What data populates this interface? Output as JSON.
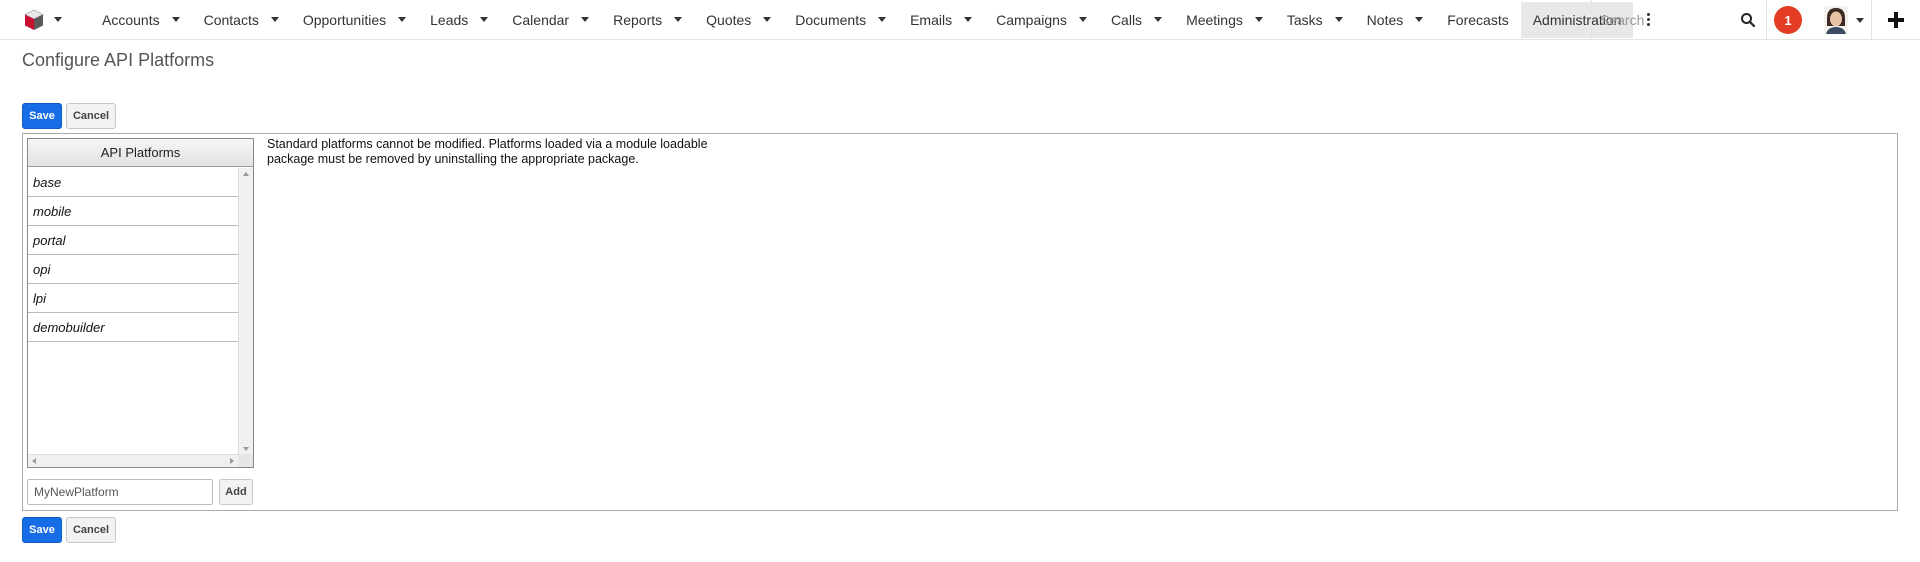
{
  "nav": {
    "tabs": [
      {
        "label": "Accounts"
      },
      {
        "label": "Contacts"
      },
      {
        "label": "Opportunities"
      },
      {
        "label": "Leads"
      },
      {
        "label": "Calendar"
      },
      {
        "label": "Reports"
      },
      {
        "label": "Quotes"
      },
      {
        "label": "Documents"
      },
      {
        "label": "Emails"
      },
      {
        "label": "Campaigns"
      },
      {
        "label": "Calls"
      },
      {
        "label": "Meetings"
      },
      {
        "label": "Tasks"
      },
      {
        "label": "Notes"
      },
      {
        "label": "Forecasts"
      },
      {
        "label": "Administration"
      }
    ],
    "search_placeholder": "Search",
    "notification_count": "1"
  },
  "page": {
    "title": "Configure API Platforms",
    "save_label": "Save",
    "cancel_label": "Cancel"
  },
  "platforms": {
    "header": "API Platforms",
    "items": [
      "base",
      "mobile",
      "portal",
      "opi",
      "lpi",
      "demobuilder"
    ],
    "info_text": "Standard platforms cannot be modified. Platforms loaded via a module loadable package must be removed by uninstalling the appropriate package.",
    "input_value": "MyNewPlatform",
    "add_label": "Add"
  },
  "colors": {
    "primary_button": "#176de5",
    "notification_badge": "#e23d24",
    "active_tab_bg": "#e8e8e8"
  }
}
